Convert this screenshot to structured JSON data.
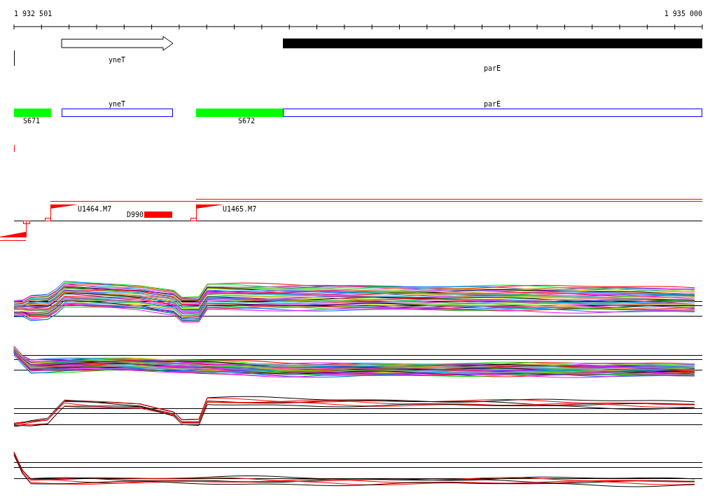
{
  "ruler": {
    "start": "1 932 501",
    "end": "1 935 000"
  },
  "genes": [
    {
      "label": "yneT",
      "kind": "arrow"
    },
    {
      "label": "parE",
      "kind": "bar"
    }
  ],
  "annotations": [
    {
      "label": "S671",
      "kind": "segment"
    },
    {
      "label": "yneT",
      "kind": "gene"
    },
    {
      "label": "S672",
      "kind": "segment"
    },
    {
      "label": "parE",
      "kind": "gene"
    }
  ],
  "regulators": [
    {
      "label": "U1464.M7",
      "kind": "promoter"
    },
    {
      "label": "D990",
      "kind": "terminator"
    },
    {
      "label": "U1465.M7",
      "kind": "promoter"
    }
  ]
}
